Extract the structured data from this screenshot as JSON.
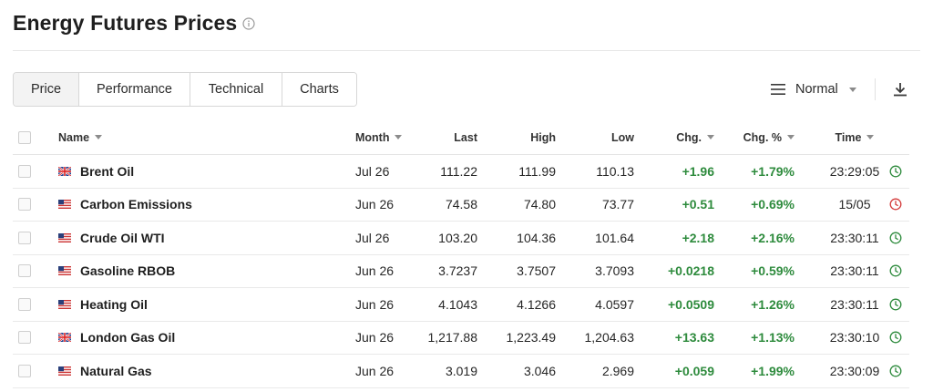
{
  "page": {
    "title": "Energy Futures Prices"
  },
  "tabs": [
    {
      "label": "Price",
      "active": true
    },
    {
      "label": "Performance",
      "active": false
    },
    {
      "label": "Technical",
      "active": false
    },
    {
      "label": "Charts",
      "active": false
    }
  ],
  "view_select": {
    "value": "Normal",
    "icon": "menu-icon"
  },
  "toolbar": {
    "download_icon": "download-icon"
  },
  "table": {
    "columns": {
      "name": "Name",
      "month": "Month",
      "last": "Last",
      "high": "High",
      "low": "Low",
      "chg": "Chg.",
      "chg_pct": "Chg. %",
      "time": "Time"
    },
    "rows": [
      {
        "flag": "uk",
        "name": "Brent Oil",
        "month": "Jul 26",
        "last": "111.22",
        "high": "111.99",
        "low": "110.13",
        "chg": "+1.96",
        "chg_pct": "+1.79%",
        "time": "23:29:05",
        "status": "open"
      },
      {
        "flag": "us",
        "name": "Carbon Emissions",
        "month": "Jun 26",
        "last": "74.58",
        "high": "74.80",
        "low": "73.77",
        "chg": "+0.51",
        "chg_pct": "+0.69%",
        "time": "15/05",
        "status": "closed"
      },
      {
        "flag": "us",
        "name": "Crude Oil WTI",
        "month": "Jul 26",
        "last": "103.20",
        "high": "104.36",
        "low": "101.64",
        "chg": "+2.18",
        "chg_pct": "+2.16%",
        "time": "23:30:11",
        "status": "open"
      },
      {
        "flag": "us",
        "name": "Gasoline RBOB",
        "month": "Jun 26",
        "last": "3.7237",
        "high": "3.7507",
        "low": "3.7093",
        "chg": "+0.0218",
        "chg_pct": "+0.59%",
        "time": "23:30:11",
        "status": "open"
      },
      {
        "flag": "us",
        "name": "Heating Oil",
        "month": "Jun 26",
        "last": "4.1043",
        "high": "4.1266",
        "low": "4.0597",
        "chg": "+0.0509",
        "chg_pct": "+1.26%",
        "time": "23:30:11",
        "status": "open"
      },
      {
        "flag": "uk",
        "name": "London Gas Oil",
        "month": "Jun 26",
        "last": "1,217.88",
        "high": "1,223.49",
        "low": "1,204.63",
        "chg": "+13.63",
        "chg_pct": "+1.13%",
        "time": "23:30:10",
        "status": "open"
      },
      {
        "flag": "us",
        "name": "Natural Gas",
        "month": "Jun 26",
        "last": "3.019",
        "high": "3.046",
        "low": "2.969",
        "chg": "+0.059",
        "chg_pct": "+1.99%",
        "time": "23:30:09",
        "status": "open"
      }
    ]
  },
  "colors": {
    "positive": "#2e8b3d",
    "status_open": "#2e8b3d",
    "status_closed": "#d43c3c",
    "tab_active_bg": "#f3f3f3"
  }
}
